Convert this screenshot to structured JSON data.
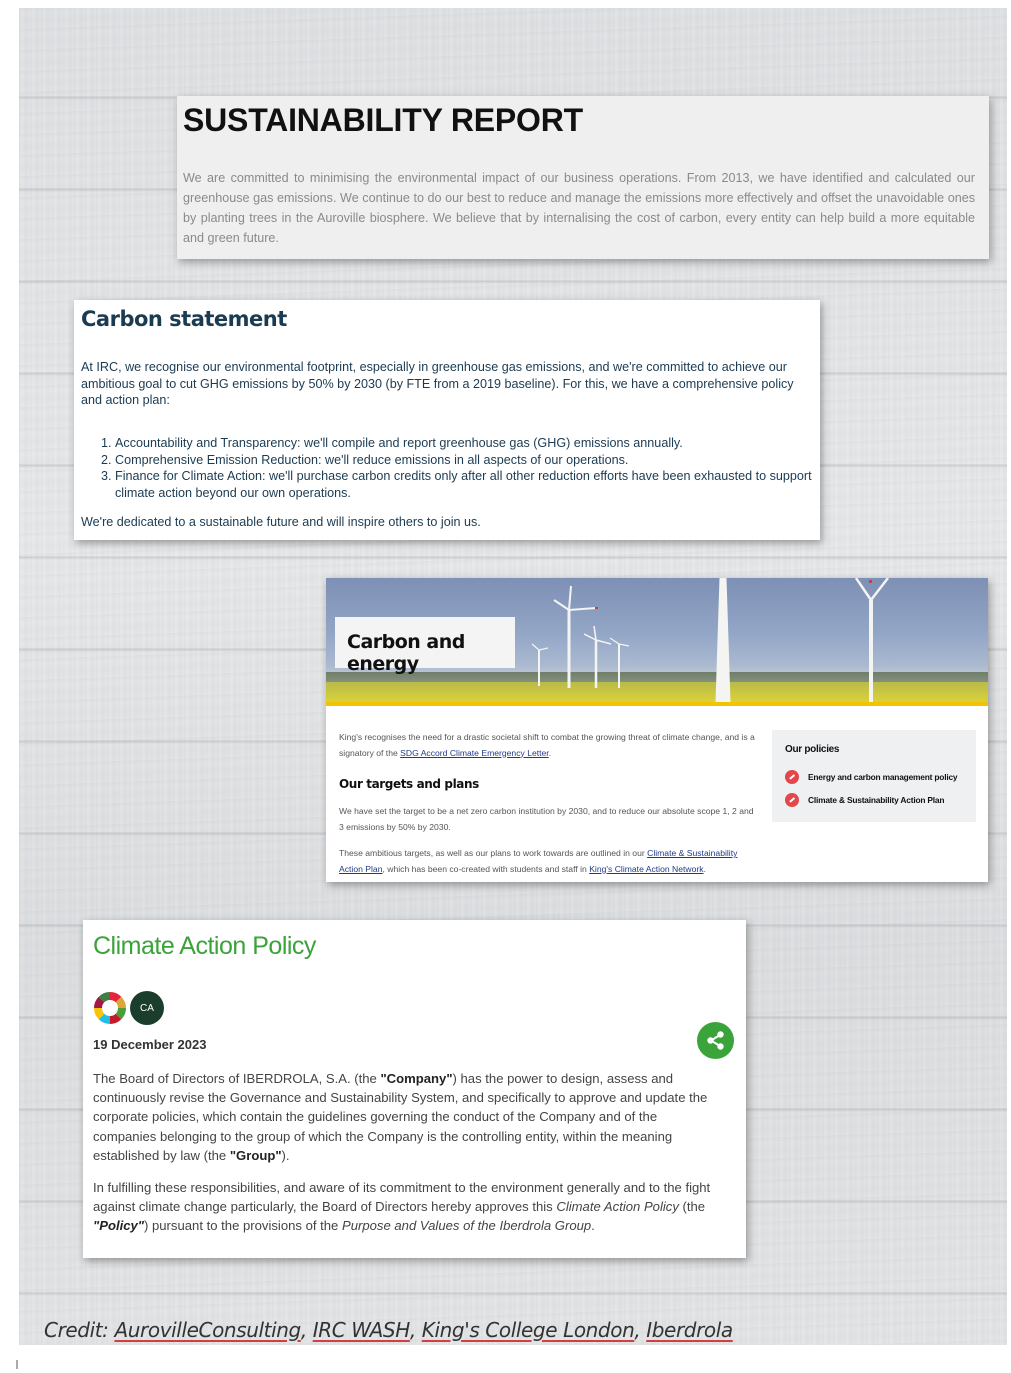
{
  "report": {
    "title": "SUSTAINABILITY REPORT",
    "body": "We are committed to minimising the environmental impact of our business operations. From 2013, we have identified and calculated our greenhouse gas emissions. We continue to do our best to reduce and manage the emissions more effectively and offset the unavoidable ones by planting trees in the Auroville biosphere. We believe that by internalising the cost of carbon, every entity can help build a more equitable and green future."
  },
  "carbon_statement": {
    "title": "Carbon statement",
    "intro": "At IRC, we recognise our environmental footprint, especially in greenhouse gas emissions, and we're committed to achieve our ambitious goal to cut GHG emissions by 50% by 2030 (by FTE from a 2019 baseline). For this, we have a comprehensive policy and action plan:",
    "items": [
      "Accountability and Transparency: we'll compile and report greenhouse gas (GHG) emissions annually.",
      "Comprehensive Emission Reduction: we'll reduce emissions in all aspects of our operations.",
      "Finance for Climate Action: we'll purchase carbon credits only after all other reduction efforts have been exhausted to support climate action beyond our own operations."
    ],
    "outro": "We're dedicated to a sustainable future and will inspire others to join us."
  },
  "carbon_energy": {
    "banner_title": "Carbon and energy",
    "intro_text": "King's recognises the need for a drastic societal shift to combat the growing threat of climate change, and is a signatory of the ",
    "intro_link": "SDG Accord Climate Emergency Letter",
    "intro_end": ".",
    "targets_heading": "Our targets and plans",
    "targets_text": "We have set the target to be a net zero carbon institution by 2030, and to reduce our absolute scope 1, 2 and 3 emissions by 50% by 2030.",
    "plans_text": "These ambitious targets, as well as our plans to work towards are outlined in our ",
    "plans_link": "Climate & Sustainability Action Plan",
    "plans_mid": ", which has been co-created with students and staff in ",
    "plans_link2": "King's Climate Action Network",
    "plans_end": ".",
    "policies_title": "Our policies",
    "policies": [
      "Energy and carbon management policy",
      "Climate & Sustainability Action Plan"
    ]
  },
  "climate_policy": {
    "title": "Climate Action Policy",
    "badge": "CA",
    "date": "19 December 2023",
    "p1": {
      "a": "The Board of Directors of IBERDROLA, S.A. (the ",
      "b": "\"Company\"",
      "c": ") has the power to design, assess and continuously revise the Governance and Sustainability System, and specifically to approve and update the corporate policies, which contain the guidelines governing the conduct of the Company and of the companies belonging to the group of which the Company is the controlling entity, within the meaning established by law (the ",
      "d": "\"Group\"",
      "e": ")."
    },
    "p2": {
      "a": "In fulfilling these responsibilities, and aware of its commitment to the environment generally and to the fight against climate change particularly, the Board of Directors hereby approves this ",
      "b": "Climate Action Policy",
      "c": " (the ",
      "d": "\"Policy\"",
      "e": ") pursuant to the provisions of the ",
      "f": "Purpose and Values of the Iberdrola Group",
      "g": "."
    }
  },
  "credit": {
    "prefix": "Credit: ",
    "sources": [
      "AurovilleConsulting",
      "IRC WASH",
      "King's College London",
      "Iberdrola"
    ],
    "sep": ", "
  },
  "colors": {
    "green": "#3aa33a",
    "navy": "#1b3b52",
    "policy_dot": "#e2484b",
    "gold": "#f3c300"
  }
}
